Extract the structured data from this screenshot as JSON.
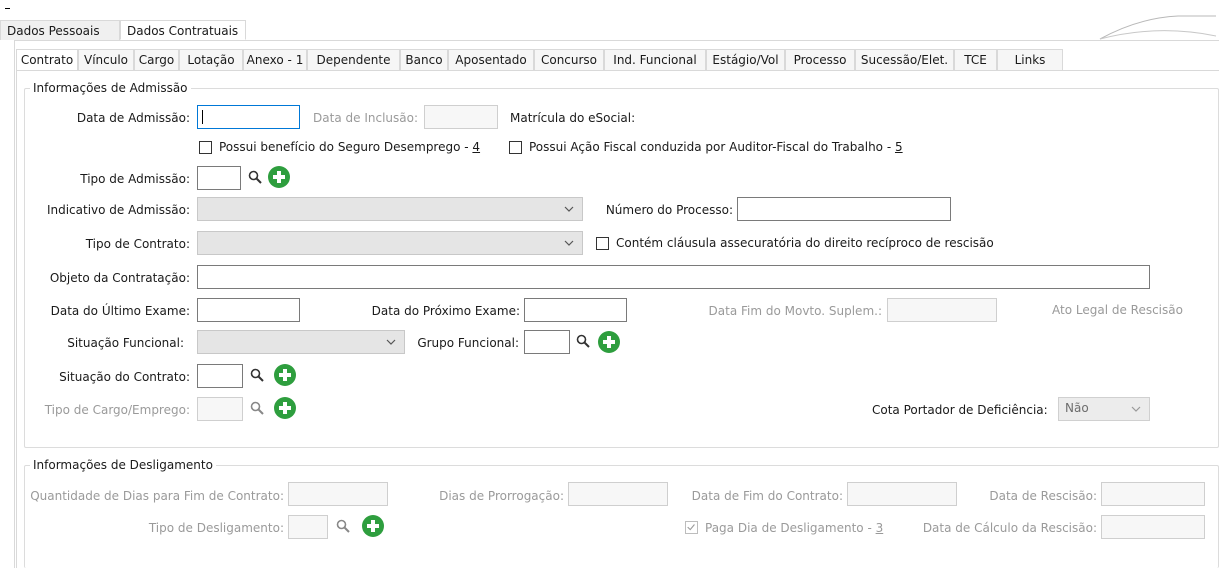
{
  "main_tabs": [
    "Dados Pessoais",
    "Dados Contratuais"
  ],
  "sub_tabs": [
    "Contrato",
    "Vínculo",
    "Cargo",
    "Lotação",
    "Anexo - 1",
    "Dependente",
    "Banco",
    "Aposentado",
    "Concurso",
    "Ind. Funcional",
    "Estágio/Vol",
    "Processo",
    "Sucessão/Elet.",
    "TCE",
    "Links"
  ],
  "admissao": {
    "group_title": "Informações de Admissão",
    "data_admissao_label": "Data de Admissão:",
    "data_inclusao_label": "Data de Inclusão:",
    "matricula_label": "Matrícula do eSocial:",
    "seguro_desemprego_label": "Possui benefício do Seguro Desemprego - ",
    "seguro_desemprego_key": "4",
    "acao_fiscal_label": "Possui Ação Fiscal conduzida por Auditor-Fiscal do Trabalho - ",
    "acao_fiscal_key": "5",
    "tipo_admissao_label": "Tipo de Admissão:",
    "indicativo_label": "Indicativo de Admissão:",
    "numero_processo_label": "Número do Processo:",
    "tipo_contrato_label": "Tipo de Contrato:",
    "clausula_label": "Contém cláusula assecuratória do direito recíproco de rescisão",
    "objeto_label": "Objeto da Contratação:",
    "ultimo_exame_label": "Data do Último Exame:",
    "proximo_exame_label": "Data do Próximo Exame:",
    "fim_movto_label": "Data Fim do Movto. Suplem.:",
    "ato_legal_label": "Ato Legal de Rescisão",
    "situacao_funcional_label": "Situação Funcional:",
    "grupo_funcional_label": "Grupo Funcional:",
    "situacao_contrato_label": "Situação do Contrato:",
    "tipo_cargo_label": "Tipo de Cargo/Emprego:",
    "cota_label": "Cota Portador de Deficiência:",
    "cota_value": "Não"
  },
  "desligamento": {
    "group_title": "Informações de Desligamento",
    "qtd_dias_label": "Quantidade de Dias para Fim de Contrato:",
    "dias_prorrogacao_label": "Dias de Prorrogação:",
    "data_fim_contrato_label": "Data de Fim do Contrato:",
    "data_rescisao_label": "Data de Rescisão:",
    "tipo_desligamento_label": "Tipo de Desligamento:",
    "paga_dia_label": "Paga Dia de Desligamento - ",
    "paga_dia_key": "3",
    "data_calculo_label": "Data de Cálculo da Rescisão:"
  },
  "colors": {
    "accent_focus": "#0078d7",
    "add_green": "#2e9e3e",
    "disabled_text": "#9a9a9a"
  }
}
